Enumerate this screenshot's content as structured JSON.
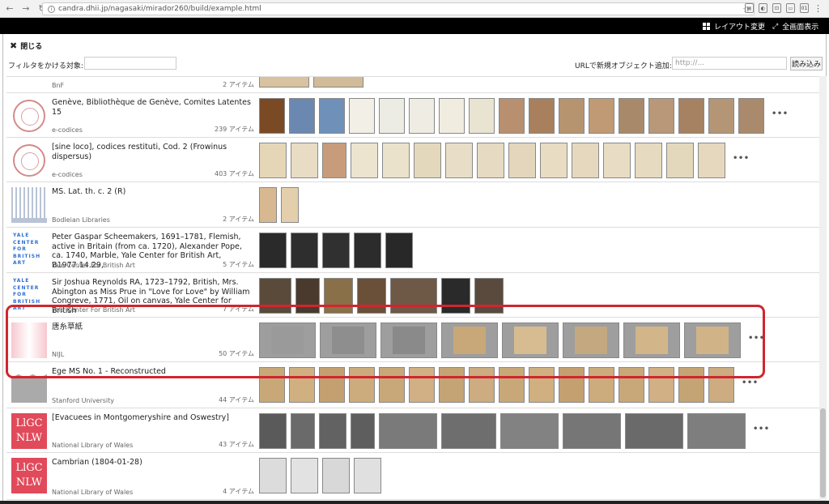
{
  "browser": {
    "url": "candra.dhii.jp/nagasaki/mirador260/build/example.html",
    "ext_icons": [
      "▤",
      "◐",
      "⊡",
      "▭",
      "01"
    ]
  },
  "header": {
    "layout_label": "レイアウト変更",
    "fullscreen_label": "全画面表示"
  },
  "panel": {
    "close_label": "閉じる",
    "filter_label": "フィルタをかける対象:",
    "filter_value": "",
    "url_add_label": "URLで新規オブジェクト追加:",
    "url_placeholder": "http://...",
    "load_label": "読み込み"
  },
  "items": [
    {
      "title": "",
      "source": "BnF",
      "count": "2 アイテム",
      "logo": "none",
      "widths": [
        62,
        62
      ],
      "colors": [
        "#d8c2a0",
        "#d2bb98"
      ]
    },
    {
      "title": "Genève, Bibliothèque de Genève, Comites Latentes 15",
      "source": "e-codices",
      "count": "239 アイテム",
      "logo": "seal",
      "widths": [
        32,
        32,
        32,
        32,
        32,
        32,
        32,
        32,
        32,
        32,
        32,
        32,
        32,
        32,
        32,
        32,
        32
      ],
      "colors": [
        "#7a4a25",
        "#6a88b0",
        "#6f90b8",
        "#f2efe6",
        "#ecebe4",
        "#efece3",
        "#f0ece0",
        "#e9e3d2",
        "#b89070",
        "#a8805e",
        "#b69470",
        "#c09a74",
        "#a88a6a",
        "#b89878",
        "#a68262",
        "#b49676",
        "#aa8a6c"
      ]
    },
    {
      "title": "[sine loco], codices restituti, Cod. 2 (Frowinus dispersus)",
      "source": "e-codices",
      "count": "403 アイテム",
      "logo": "seal",
      "widths": [
        34,
        34,
        30,
        34,
        34,
        34,
        34,
        34,
        34,
        34,
        34,
        34,
        34,
        34,
        34
      ],
      "colors": [
        "#e6d6b8",
        "#e8dcc4",
        "#c89c7a",
        "#ede4cf",
        "#ebe2cc",
        "#e4d8bc",
        "#e8dec8",
        "#e6dac2",
        "#e4d6bc",
        "#e8dcc2",
        "#e6d8be",
        "#e8dcc4",
        "#e6dac0",
        "#e4d8bc",
        "#e6d8be"
      ]
    },
    {
      "title": "MS. Lat. th. c. 2 (R)",
      "source": "Bodleian Libraries",
      "count": "2 アイテム",
      "logo": "bodleian",
      "widths": [
        22,
        22
      ],
      "colors": [
        "#d8b890",
        "#e4cfac"
      ]
    },
    {
      "title": "Peter Gaspar Scheemakers, 1691–1781, Flemish, active in Britain (from ca. 1720), Alexander Pope, ca. 1740, Marble, Yale Center for British Art, B1977.14.29,",
      "source": "Yale Center For British Art",
      "count": "5 アイテム",
      "logo": "yale",
      "widths": [
        34,
        34,
        34,
        34,
        34
      ],
      "colors": [
        "#2a2a2a",
        "#2e2e2e",
        "#303030",
        "#2c2c2c",
        "#282828"
      ]
    },
    {
      "title": "Sir Joshua Reynolds RA, 1723–1792, British, Mrs. Abington as Miss Prue in \"Love for Love\" by William Congreve, 1771, Oil on canvas, Yale Center for British",
      "source": "Yale Center For British Art",
      "count": "7 アイテム",
      "logo": "yale",
      "widths": [
        40,
        30,
        36,
        36,
        58,
        36,
        36
      ],
      "colors": [
        "#5a4a3a",
        "#4a3a2e",
        "#8a7048",
        "#6a5038",
        "#6e5846",
        "#2a2a2a",
        "#5a4a3e"
      ]
    },
    {
      "title": "唐糸草紙",
      "source": "NIJL",
      "count": "50 アイテム",
      "logo": "nijl",
      "widths": [
        70,
        70,
        70,
        70,
        70,
        70,
        70,
        70
      ],
      "colors": [
        "#9a9a9a",
        "#8e8e8e",
        "#8a8a8a",
        "#c8a878",
        "#d6bc90",
        "#c4a880",
        "#d2b68a",
        "#d0b488"
      ]
    },
    {
      "title": "Ege MS No. 1 - Reconstructed",
      "source": "Stanford University",
      "count": "44 アイテム",
      "logo": "stanford",
      "widths": [
        32,
        32,
        32,
        32,
        32,
        32,
        32,
        32,
        32,
        32,
        32,
        32,
        32,
        32,
        32,
        32
      ],
      "colors": [
        "#c8a878",
        "#d0b080",
        "#c4a070",
        "#ccac7c",
        "#c8a878",
        "#d0b084",
        "#c4a474",
        "#ccac80",
        "#c8a878",
        "#d0b080",
        "#c4a070",
        "#ccac7c",
        "#c8a878",
        "#d0b084",
        "#c4a474",
        "#ccac80"
      ]
    },
    {
      "title": "[Evacuees in Montgomeryshire and Oswestry]",
      "source": "National Library of Wales",
      "count": "43 アイテム",
      "logo": "nlw",
      "widths": [
        34,
        30,
        34,
        30,
        72,
        68,
        72,
        72,
        72,
        72
      ],
      "colors": [
        "#5a5a5a",
        "#6a6a6a",
        "#626262",
        "#5e5e5e",
        "#7a7a7a",
        "#6e6e6e",
        "#828282",
        "#767676",
        "#6a6a6a",
        "#7e7e7e"
      ]
    },
    {
      "title": "Cambrian (1804-01-28)",
      "source": "National Library of Wales",
      "count": "4 アイテム",
      "logo": "nlw",
      "widths": [
        34,
        34,
        34,
        34
      ],
      "colors": [
        "#dcdcdc",
        "#e2e2e2",
        "#d8d8d8",
        "#e0e0e0"
      ]
    }
  ],
  "more_label": "•••",
  "logo_text": {
    "yale": [
      "YALE",
      "CENTER",
      "FOR",
      "BRITISH",
      "ART"
    ],
    "nlw": [
      "LlGC",
      "NLW"
    ]
  }
}
